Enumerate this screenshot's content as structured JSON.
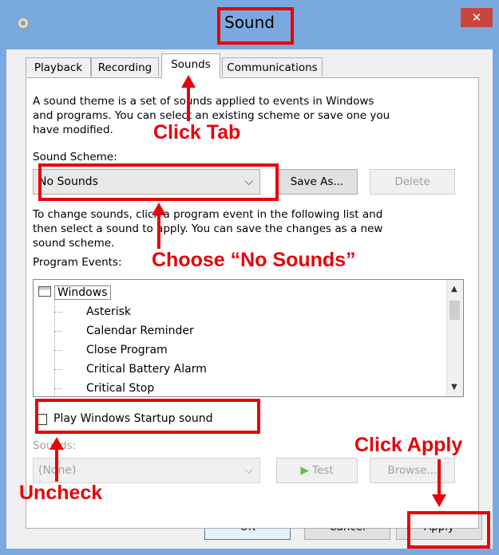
{
  "window": {
    "title": "Sound",
    "close_glyph": "✕",
    "icon": "speaker-icon"
  },
  "tabs": [
    {
      "label": "Playback",
      "active": false
    },
    {
      "label": "Recording",
      "active": false
    },
    {
      "label": "Sounds",
      "active": true
    },
    {
      "label": "Communications",
      "active": false
    }
  ],
  "sounds_tab": {
    "intro_line1": "A sound theme is a set of sounds applied to events in Windows",
    "intro_line2": "and programs.  You can select an existing scheme or save one you",
    "intro_line3": "have modified.",
    "scheme_label": "Sound Scheme:",
    "scheme_value": "No Sounds",
    "save_as_label": "Save As...",
    "delete_label": "Delete",
    "change_line1": "To change sounds, click a program event in the following list and",
    "change_line2": "then select a sound to apply.  You can save the changes as a new",
    "change_line3": "sound scheme.",
    "events_label": "Program Events:",
    "events_root": "Windows",
    "events": [
      "Asterisk",
      "Calendar Reminder",
      "Close Program",
      "Critical Battery Alarm",
      "Critical Stop"
    ],
    "startup_checkbox_label": "Play Windows Startup sound",
    "startup_checked": false,
    "sounds_label": "Sounds:",
    "sounds_value": "(None)",
    "test_label": "Test",
    "browse_label": "Browse..."
  },
  "footer": {
    "ok_label": "OK",
    "cancel_label": "Cancel",
    "apply_label": "Apply"
  },
  "annotations": {
    "click_tab": "Click Tab",
    "choose_no_sounds": "Choose “No Sounds”",
    "uncheck": "Uncheck",
    "click_apply": "Click Apply"
  },
  "colors": {
    "annotation": "#e8000a",
    "titlebar": "#7aa9df",
    "close_button": "#c7463b"
  }
}
